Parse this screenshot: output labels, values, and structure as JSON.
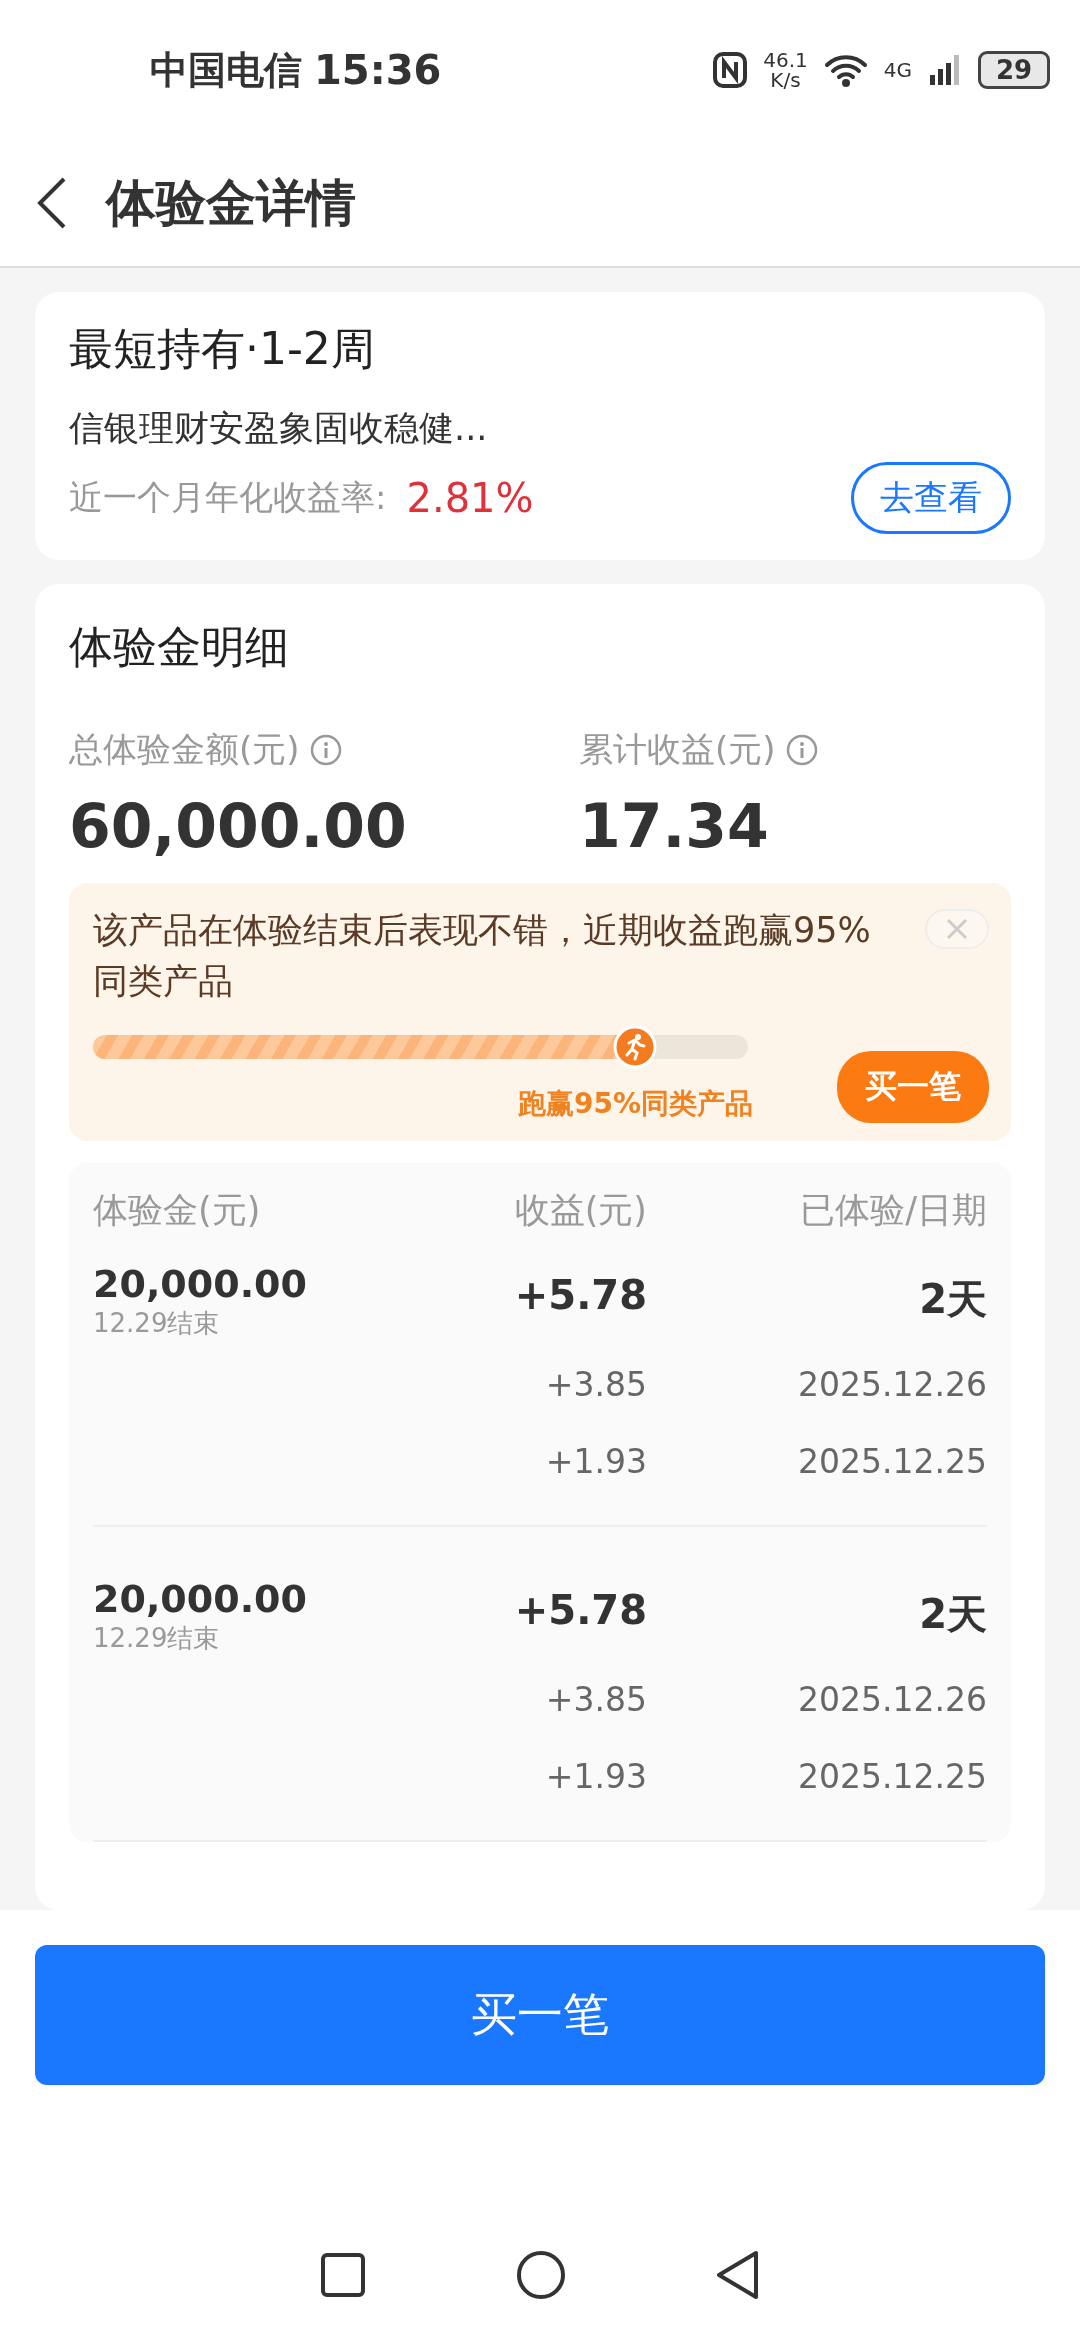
{
  "status_bar": {
    "carrier": "中国电信",
    "time": "15:36",
    "speed_value": "46.1",
    "speed_unit": "K/s",
    "network": "4G",
    "battery": "29"
  },
  "header": {
    "title": "体验金详情"
  },
  "product_card": {
    "title": "最短持有·1-2周",
    "name": "信银理财安盈象固收稳健...",
    "rate_label": "近一个月年化收益率:",
    "rate": "2.81%",
    "action": "去查看"
  },
  "detail_card": {
    "title": "体验金明细",
    "stats": [
      {
        "label": "总体验金额(元)",
        "value": "60,000.00"
      },
      {
        "label": "累计收益(元)",
        "value": "17.34"
      }
    ],
    "banner": {
      "text": "该产品在体验结束后表现不错，近期收益跑赢95%同类产品",
      "progress": {
        "level": 0.84
      },
      "progress_label": "跑赢95%同类产品",
      "button": "买一笔"
    },
    "table": {
      "columns": [
        "体验金(元)",
        "收益(元)",
        "已体验/日期"
      ],
      "rows": [
        {
          "amount": "20,000.00",
          "end": "12.29结束",
          "entries": [
            {
              "kind": "total",
              "income": "+5.78",
              "date": "2天"
            },
            {
              "kind": "daily",
              "income": "+3.85",
              "date": "2025.12.26"
            },
            {
              "kind": "daily",
              "income": "+1.93",
              "date": "2025.12.25"
            }
          ]
        },
        {
          "amount": "20,000.00",
          "end": "12.29结束",
          "entries": [
            {
              "kind": "total",
              "income": "+5.78",
              "date": "2天"
            },
            {
              "kind": "daily",
              "income": "+3.85",
              "date": "2025.12.26"
            },
            {
              "kind": "daily",
              "income": "+1.93",
              "date": "2025.12.25"
            }
          ]
        }
      ]
    }
  },
  "bottom_button": "买一笔"
}
